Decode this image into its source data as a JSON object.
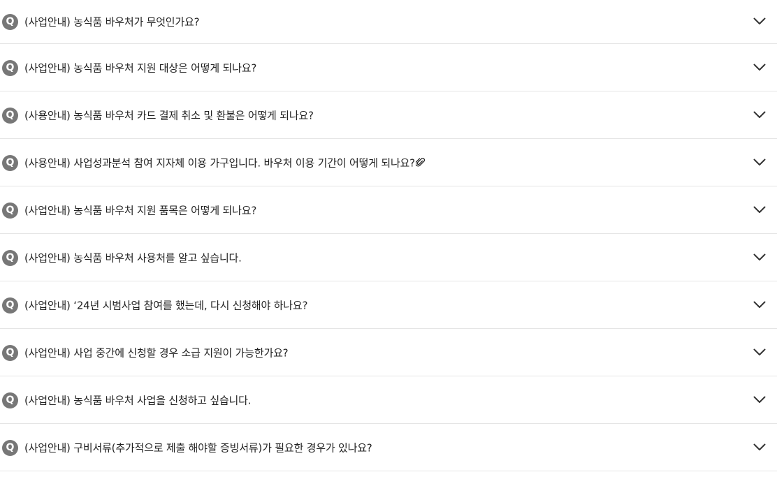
{
  "faq": {
    "badge": "Q",
    "items": [
      {
        "question": "(사업안내) 농식품 바우처가 무엇인가요?",
        "attachment": false,
        "expand_icon": "chevron-down-icon"
      },
      {
        "question": "(사업안내) 농식품 바우처 지원 대상은 어떻게 되나요?",
        "attachment": false,
        "expand_icon": "chevron-down-icon"
      },
      {
        "question": "(사용안내) 농식품 바우처 카드 결제 취소 및 환불은 어떻게 되나요?",
        "attachment": false,
        "expand_icon": "chevron-down-icon"
      },
      {
        "question": "(사용안내) 사업성과분석 참여 지자체 이용 가구입니다. 바우처 이용 기간이 어떻게 되나요?",
        "attachment": true,
        "attachment_icon": "paperclip-icon",
        "expand_icon": "chevron-down-icon"
      },
      {
        "question": "(사업안내) 농식품 바우처 지원 품목은 어떻게 되나요?",
        "attachment": false,
        "expand_icon": "chevron-down-icon"
      },
      {
        "question": "(사업안내) 농식품 바우처 사용처를 알고 싶습니다.",
        "attachment": false,
        "expand_icon": "chevron-down-icon"
      },
      {
        "question": "(사업안내) ‘24년 시범사업 참여를 했는데, 다시 신청해야 하나요?",
        "attachment": false,
        "expand_icon": "chevron-down-icon"
      },
      {
        "question": "(사업안내) 사업 중간에 신청할 경우 소급 지원이 가능한가요?",
        "attachment": false,
        "expand_icon": "chevron-down-icon"
      },
      {
        "question": "(사업안내) 농식품 바우처 사업을 신청하고 싶습니다.",
        "attachment": false,
        "expand_icon": "chevron-down-icon"
      },
      {
        "question": "(사업안내) 구비서류(추가적으로 제출 해야할 증빙서류)가 필요한 경우가 있나요?",
        "attachment": false,
        "expand_icon": "chevron-down-icon"
      }
    ]
  },
  "colors": {
    "badge_bg": "#777777",
    "text": "#222222",
    "divider": "#e5e5e5",
    "chevron": "#333333"
  }
}
